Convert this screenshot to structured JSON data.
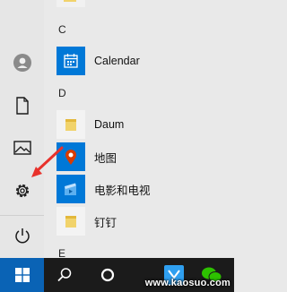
{
  "start_menu": {
    "sections": [
      {
        "letter": "C",
        "apps": [
          {
            "label": "Calendar",
            "icon": "calendar-icon"
          }
        ]
      },
      {
        "letter": "D",
        "apps": [
          {
            "label": "Daum",
            "icon": "folder-icon"
          },
          {
            "label": "地图",
            "icon": "map-pin-icon"
          },
          {
            "label": "电影和电视",
            "icon": "movies-tv-icon"
          },
          {
            "label": "钉钉",
            "icon": "folder-icon"
          }
        ]
      },
      {
        "letter": "E",
        "apps": []
      }
    ]
  },
  "rail": [
    "user-icon",
    "document-icon",
    "pictures-icon",
    "settings-icon",
    "power-icon"
  ],
  "taskbar": [
    "windows-start-icon",
    "search-icon",
    "task-view-icon",
    "app-icon",
    "wechat-icon"
  ],
  "watermark": "www.kaosuo.com",
  "colors": {
    "accent": "#0078d7",
    "arrow": "#e8322c",
    "taskbar": "#1b1b1b"
  }
}
